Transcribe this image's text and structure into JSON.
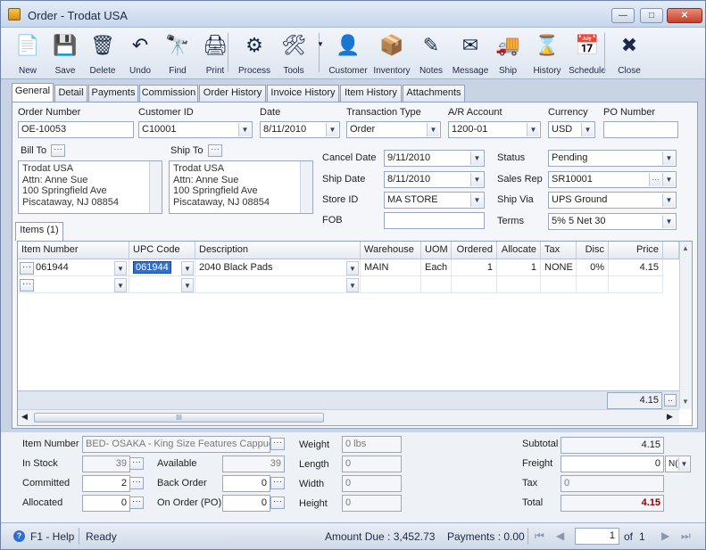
{
  "window": {
    "title": "Order - Trodat USA",
    "min": "—",
    "max": "□",
    "close": "✕"
  },
  "toolbar": [
    {
      "label": "New",
      "icon": "new-doc-icon",
      "glyph": "📄"
    },
    {
      "label": "Save",
      "icon": "save-icon",
      "glyph": "💾"
    },
    {
      "label": "Delete",
      "icon": "recycle-bin-icon",
      "glyph": "🗑"
    },
    {
      "label": "Undo",
      "icon": "undo-icon",
      "glyph": "↶"
    },
    {
      "label": "Find",
      "icon": "binoculars-icon",
      "glyph": "🔭"
    },
    {
      "label": "Print",
      "icon": "printer-icon",
      "glyph": "🖨"
    },
    {
      "label": "Process",
      "icon": "process-icon",
      "glyph": "⚙"
    },
    {
      "label": "Tools",
      "icon": "tools-icon",
      "glyph": "🛠"
    },
    {
      "label": "Customer",
      "icon": "customer-icon",
      "glyph": "👤"
    },
    {
      "label": "Inventory",
      "icon": "boxes-icon",
      "glyph": "📦"
    },
    {
      "label": "Notes",
      "icon": "notes-pen-icon",
      "glyph": "✎"
    },
    {
      "label": "Message",
      "icon": "message-icon",
      "glyph": "✉"
    },
    {
      "label": "Ship",
      "icon": "ship-icon",
      "glyph": "🚚"
    },
    {
      "label": "History",
      "icon": "history-icon",
      "glyph": "⌛"
    },
    {
      "label": "Schedule",
      "icon": "schedule-icon",
      "glyph": "📅"
    },
    {
      "label": "Close",
      "icon": "close-doc-icon",
      "glyph": "✖"
    }
  ],
  "tools_caret": "▼",
  "tabs": [
    "General",
    "Detail",
    "Payments",
    "Commission",
    "Order History",
    "Invoice History",
    "Item History",
    "Attachments"
  ],
  "header": {
    "order_number_label": "Order Number",
    "order_number": "OE-10053",
    "customer_id_label": "Customer ID",
    "customer_id": "C10001",
    "date_label": "Date",
    "date": "8/11/2010",
    "transaction_type_label": "Transaction Type",
    "transaction_type": "Order",
    "ar_account_label": "A/R Account",
    "ar_account": "1200-01",
    "currency_label": "Currency",
    "currency": "USD",
    "po_number_label": "PO Number",
    "po_number": ""
  },
  "bill_to": {
    "label": "Bill To",
    "lines": [
      "Trodat USA",
      "Attn: Anne Sue",
      "100 Springfield Ave",
      "Piscataway, NJ 08854"
    ]
  },
  "ship_to": {
    "label": "Ship To",
    "lines": [
      "Trodat USA",
      "Attn: Anne Sue",
      "100 Springfield Ave",
      "Piscataway, NJ 08854"
    ]
  },
  "mid": {
    "cancel_date_label": "Cancel  Date",
    "cancel_date": "9/11/2010",
    "ship_date_label": "Ship Date",
    "ship_date": "8/11/2010",
    "store_id_label": "Store ID",
    "store_id": "MA STORE",
    "fob_label": "FOB",
    "fob": ""
  },
  "right": {
    "status_label": "Status",
    "status": "Pending",
    "sales_rep_label": "Sales Rep",
    "sales_rep": "SR10001",
    "ship_via_label": "Ship Via",
    "ship_via": "UPS Ground",
    "terms_label": "Terms",
    "terms": "5% 5 Net 30"
  },
  "items_tab": "Items (1)",
  "columns": [
    "Item Number",
    "UPC Code",
    "Description",
    "Warehouse",
    "UOM",
    "Ordered",
    "Allocate",
    "Tax",
    "Disc",
    "Price"
  ],
  "rows": [
    {
      "item": "061944",
      "upc": "061944",
      "desc": "2040 Black Pads",
      "warehouse": "MAIN",
      "uom": "Each",
      "ordered": "1",
      "allocate": "1",
      "tax": "NONE",
      "disc": "0%",
      "price": "4.15"
    }
  ],
  "grid_total": "4.15",
  "scroll_grip": "III",
  "bottom": {
    "item_number_label": "Item Number",
    "item_number": "BED- OSAKA - King Size Features Cappuccino",
    "in_stock_label": "In Stock",
    "in_stock": "39",
    "committed_label": "Committed",
    "committed": "2",
    "allocated_label": "Allocated",
    "allocated": "0",
    "available_label": "Available",
    "available": "39",
    "back_order_label": "Back Order",
    "back_order": "0",
    "on_order_label": "On Order (PO)",
    "on_order": "0",
    "weight_label": "Weight",
    "weight": "0 lbs",
    "length_label": "Length",
    "length": "0",
    "width_label": "Width",
    "width": "0",
    "height_label": "Height",
    "height": "0",
    "subtotal_label": "Subtotal",
    "subtotal": "4.15",
    "freight_label": "Freight",
    "freight": "0",
    "freight_code": "N(",
    "tax_label": "Tax",
    "tax": "0",
    "total_label": "Total",
    "total": "4.15"
  },
  "status": {
    "help": "F1 - Help",
    "ready": "Ready",
    "amount_due": "Amount Due : 3,452.73",
    "payments": "Payments : 0.00",
    "page": "1",
    "of": "of",
    "pages": "1"
  },
  "colors": {
    "accent": "#2f6fd0",
    "total_text": "#8b0000"
  }
}
